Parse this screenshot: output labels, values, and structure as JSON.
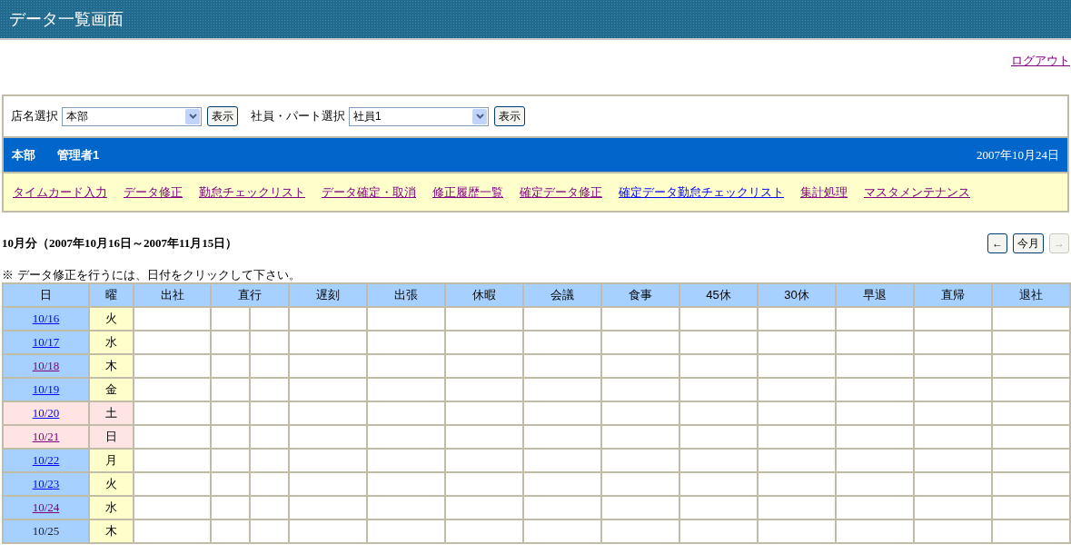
{
  "header": {
    "title": "データ一覧画面"
  },
  "logout_link": "ログアウト",
  "selectors": [
    {
      "label": "店名選択",
      "value": "本部",
      "button": "表示"
    },
    {
      "label": "社員・パート選択",
      "value": "社員1",
      "button": "表示"
    }
  ],
  "user_bar": {
    "store": "本部",
    "user": "管理者1",
    "date": "2007年10月24日"
  },
  "nav_links": [
    {
      "label": "タイムカード入力",
      "visited": true
    },
    {
      "label": "データ修正",
      "visited": true
    },
    {
      "label": "勤怠チェックリスト",
      "visited": true
    },
    {
      "label": "データ確定・取消",
      "visited": true
    },
    {
      "label": "修正履歴一覧",
      "visited": true
    },
    {
      "label": "確定データ修正",
      "visited": true
    },
    {
      "label": "確定データ勤怠チェックリスト",
      "visited": false
    },
    {
      "label": "集計処理",
      "visited": true
    },
    {
      "label": "マスタメンテナンス",
      "visited": true
    }
  ],
  "period_title": "10月分（2007年10月16日～2007年11月15日）",
  "month_buttons": [
    {
      "label": "←",
      "disabled": false
    },
    {
      "label": "今月",
      "disabled": false
    },
    {
      "label": "→",
      "disabled": true
    }
  ],
  "note": "※ データ修正を行うには、日付をクリックして下さい。",
  "table": {
    "columns": [
      "日",
      "曜",
      "出社",
      "直行",
      "遅刻",
      "出張",
      "休暇",
      "会議",
      "食事",
      "45休",
      "30休",
      "早退",
      "直帰",
      "退社"
    ],
    "rows": [
      {
        "date": "10/16",
        "weekday": "火",
        "weekend": false,
        "link": true,
        "visited": false
      },
      {
        "date": "10/17",
        "weekday": "水",
        "weekend": false,
        "link": true,
        "visited": false
      },
      {
        "date": "10/18",
        "weekday": "木",
        "weekend": false,
        "link": true,
        "visited": true
      },
      {
        "date": "10/19",
        "weekday": "金",
        "weekend": false,
        "link": true,
        "visited": false
      },
      {
        "date": "10/20",
        "weekday": "土",
        "weekend": true,
        "link": true,
        "visited": false
      },
      {
        "date": "10/21",
        "weekday": "日",
        "weekend": true,
        "link": true,
        "visited": true
      },
      {
        "date": "10/22",
        "weekday": "月",
        "weekend": false,
        "link": true,
        "visited": false
      },
      {
        "date": "10/23",
        "weekday": "火",
        "weekend": false,
        "link": true,
        "visited": false
      },
      {
        "date": "10/24",
        "weekday": "水",
        "weekend": false,
        "link": true,
        "visited": true
      },
      {
        "date": "10/25",
        "weekday": "木",
        "weekend": false,
        "link": false
      }
    ]
  }
}
